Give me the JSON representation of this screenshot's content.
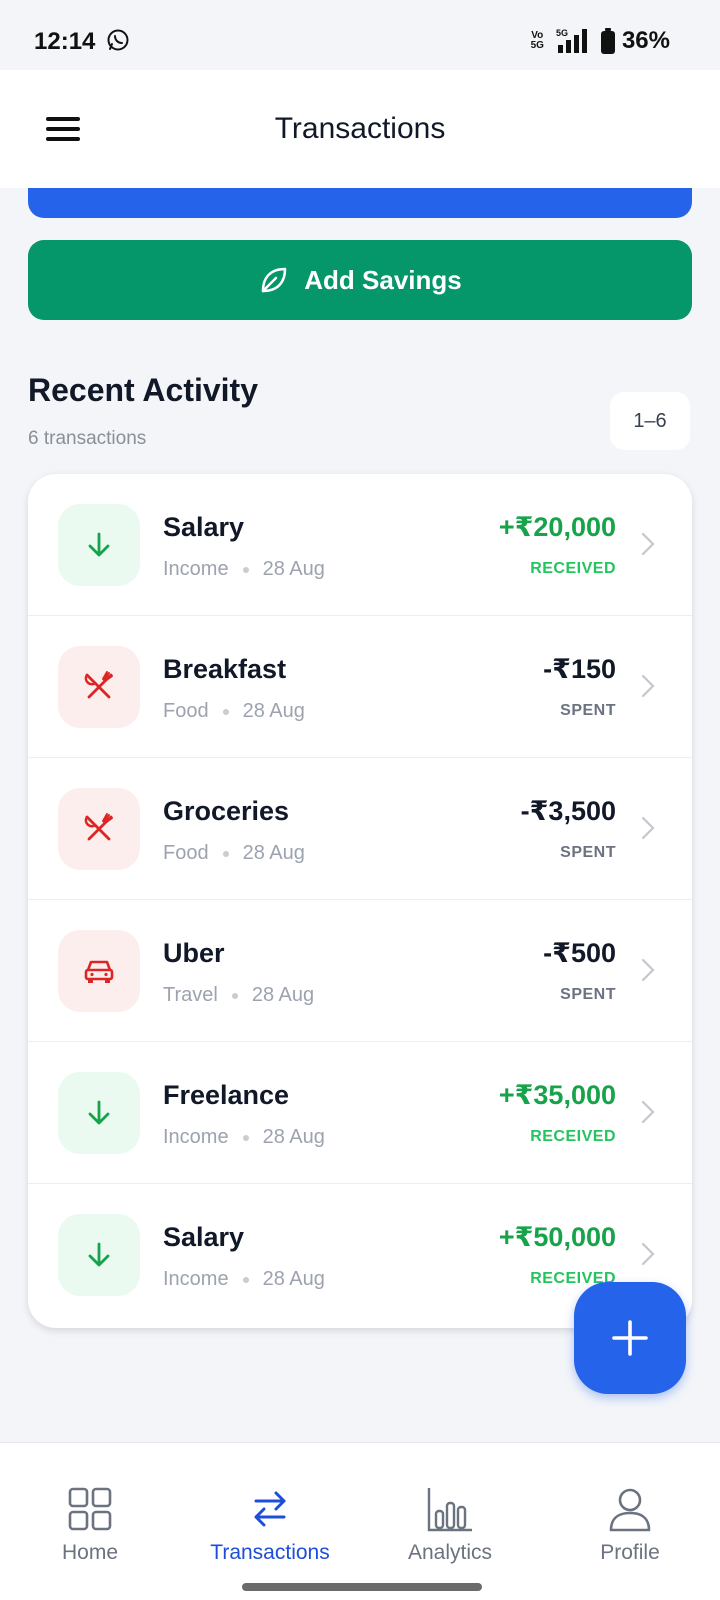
{
  "status_bar": {
    "time": "12:14",
    "network_top": "Vo",
    "network_bottom": "5G",
    "signal": "5G",
    "battery": "36%"
  },
  "header": {
    "title": "Transactions"
  },
  "actions": {
    "add_savings_label": "Add Savings"
  },
  "recent": {
    "title": "Recent Activity",
    "count_text": "6 transactions",
    "range": "1–6"
  },
  "transactions": [
    {
      "title": "Salary",
      "category": "Income",
      "date": "28 Aug",
      "amount": "+₹20,000",
      "status": "RECEIVED",
      "type": "income",
      "icon": "arrow-down-icon"
    },
    {
      "title": "Breakfast",
      "category": "Food",
      "date": "28 Aug",
      "amount": "-₹150",
      "status": "SPENT",
      "type": "expense",
      "icon": "utensils-icon"
    },
    {
      "title": "Groceries",
      "category": "Food",
      "date": "28 Aug",
      "amount": "-₹3,500",
      "status": "SPENT",
      "type": "expense",
      "icon": "utensils-icon"
    },
    {
      "title": "Uber",
      "category": "Travel",
      "date": "28 Aug",
      "amount": "-₹500",
      "status": "SPENT",
      "type": "expense",
      "icon": "car-icon"
    },
    {
      "title": "Freelance",
      "category": "Income",
      "date": "28 Aug",
      "amount": "+₹35,000",
      "status": "RECEIVED",
      "type": "income",
      "icon": "arrow-down-icon"
    },
    {
      "title": "Salary",
      "category": "Income",
      "date": "28 Aug",
      "amount": "+₹50,000",
      "status": "RECEIVED",
      "type": "income",
      "icon": "arrow-down-icon"
    }
  ],
  "nav": {
    "home": "Home",
    "transactions": "Transactions",
    "analytics": "Analytics",
    "profile": "Profile"
  },
  "colors": {
    "primary": "#2563eb",
    "savings": "#059669",
    "income": "#16a34a",
    "expense_icon": "#dc2626"
  }
}
